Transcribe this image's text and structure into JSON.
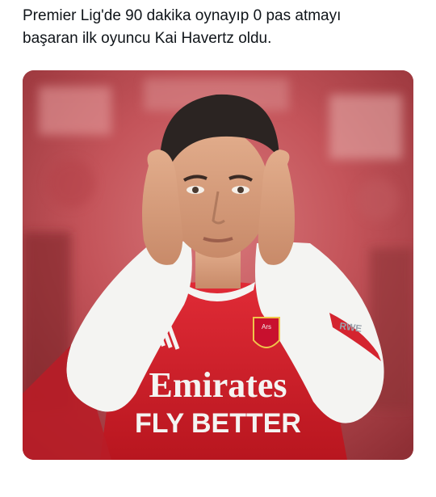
{
  "tweet": {
    "text": "Premier Lig'de 90 dakika oynayıp 0 pas atmayı\nbaşaran ilk oyuncu Kai Havertz oldu."
  },
  "media": {
    "description_icon": "photo",
    "shirt_sponsor_line1": "Emirates",
    "shirt_sponsor_line2": "FLY BETTER",
    "sleeve_logo_text": "RWE",
    "crest_text": "Ars",
    "colors": {
      "shirt_red": "#d4242f",
      "sleeve_white": "#f4f4f2",
      "background_blur": "#c4545a"
    }
  }
}
